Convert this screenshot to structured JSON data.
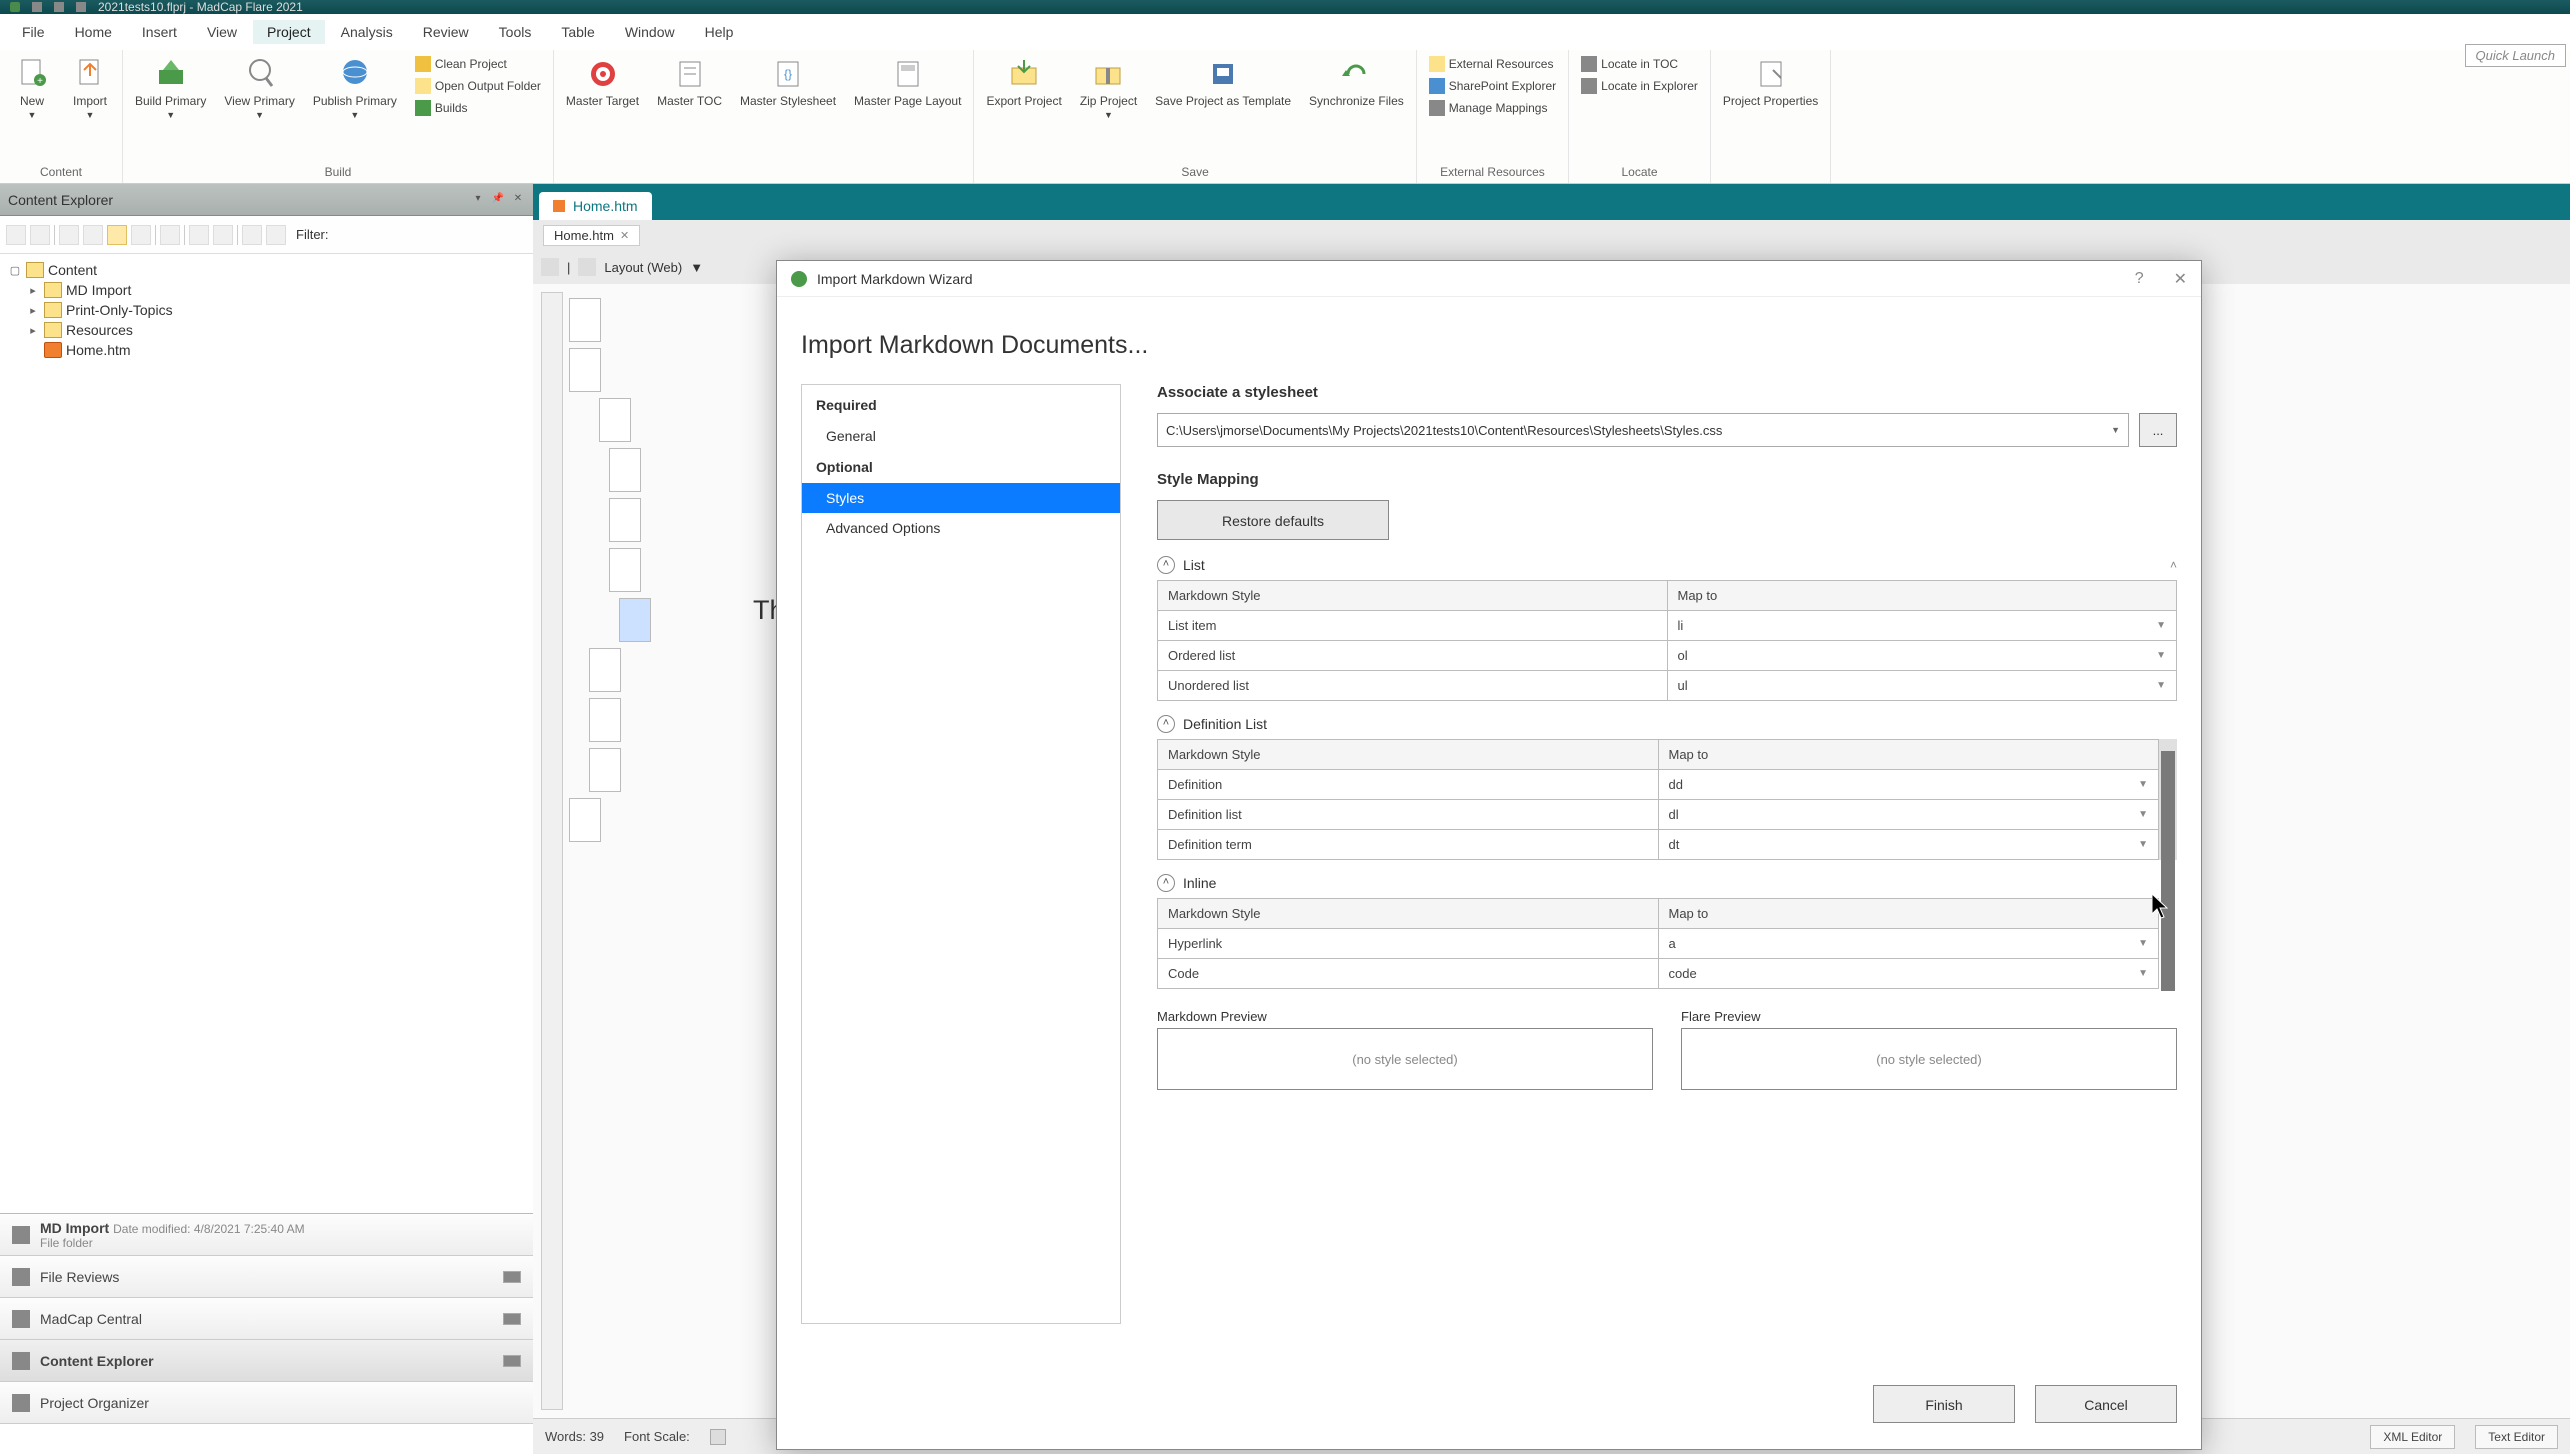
{
  "app": {
    "title": "2021tests10.flprj - MadCap Flare 2021",
    "quick_launch": "Quick Launch"
  },
  "menubar": [
    "File",
    "Home",
    "Insert",
    "View",
    "Project",
    "Analysis",
    "Review",
    "Tools",
    "Table",
    "Window",
    "Help"
  ],
  "menubar_active_index": 4,
  "ribbon": {
    "groups": [
      {
        "label": "Content",
        "items": [
          {
            "t": "New",
            "drop": true,
            "big": true
          },
          {
            "t": "Import",
            "drop": true,
            "big": true
          }
        ]
      },
      {
        "label": "Build",
        "items": [
          {
            "t": "Build Primary",
            "drop": true,
            "big": true
          },
          {
            "t": "View Primary",
            "drop": true,
            "big": true
          },
          {
            "t": "Publish Primary",
            "drop": true,
            "big": true
          }
        ],
        "side": [
          {
            "t": "Clean Project"
          },
          {
            "t": "Open Output Folder"
          },
          {
            "t": "Builds"
          }
        ]
      },
      {
        "label": "",
        "items": [
          {
            "t": "Master Target",
            "big": true
          },
          {
            "t": "Master TOC",
            "big": true
          },
          {
            "t": "Master Stylesheet",
            "big": true
          },
          {
            "t": "Master Page Layout",
            "big": true
          }
        ]
      },
      {
        "label": "Save",
        "items": [
          {
            "t": "Export Project",
            "big": true
          },
          {
            "t": "Zip Project",
            "drop": true,
            "big": true
          },
          {
            "t": "Save Project as Template",
            "big": true
          },
          {
            "t": "Synchronize Files",
            "big": true
          }
        ]
      },
      {
        "label": "External Resources",
        "side": [
          {
            "t": "External Resources"
          },
          {
            "t": "SharePoint Explorer"
          },
          {
            "t": "Manage Mappings"
          }
        ]
      },
      {
        "label": "Locate",
        "side": [
          {
            "t": "Locate in TOC"
          },
          {
            "t": "Locate in Explorer"
          }
        ]
      },
      {
        "label": "",
        "items": [
          {
            "t": "Project Properties",
            "big": true
          }
        ]
      }
    ]
  },
  "panel": {
    "title": "Content Explorer",
    "filter_label": "Filter:"
  },
  "tree": [
    {
      "label": "Content",
      "depth": 0,
      "exp": "-",
      "type": "folder"
    },
    {
      "label": "MD Import",
      "depth": 1,
      "exp": "+",
      "type": "folder"
    },
    {
      "label": "Print-Only-Topics",
      "depth": 1,
      "exp": "+",
      "type": "folder"
    },
    {
      "label": "Resources",
      "depth": 1,
      "exp": "+",
      "type": "folder"
    },
    {
      "label": "Home.htm",
      "depth": 1,
      "exp": "",
      "type": "htm"
    }
  ],
  "panel_bottom": [
    {
      "label": "MD Import",
      "meta": "Date modified:   4/8/2021 7:25:40 AM",
      "sub": "File folder"
    },
    {
      "label": "File Reviews"
    },
    {
      "label": "MadCap Central"
    },
    {
      "label": "Content Explorer",
      "active": true
    },
    {
      "label": "Project Organizer"
    }
  ],
  "doc": {
    "tab_title": "Home.htm",
    "inner_tab": "Home.htm",
    "layout": "Layout (Web)",
    "content_snippet": "sit. This website contains the followi",
    "words_label": "Words:",
    "words": "39",
    "font_scale_label": "Font Scale:",
    "xml": "XML Editor",
    "txt": "Text Editor"
  },
  "wizard": {
    "title": "Import Markdown Wizard",
    "main_title": "Import Markdown Documents...",
    "nav": {
      "required": "Required",
      "general": "General",
      "optional": "Optional",
      "styles": "Styles",
      "advanced": "Advanced Options"
    },
    "associate_label": "Associate a stylesheet",
    "stylesheet_path": "C:\\Users\\jmorse\\Documents\\My Projects\\2021tests10\\Content\\Resources\\Stylesheets\\Styles.css",
    "browse": "...",
    "style_mapping": "Style Mapping",
    "restore": "Restore defaults",
    "col_md": "Markdown Style",
    "col_map": "Map to",
    "groups": [
      {
        "name": "List",
        "rows": [
          [
            "List item",
            "li"
          ],
          [
            "Ordered list",
            "ol"
          ],
          [
            "Unordered list",
            "ul"
          ]
        ]
      },
      {
        "name": "Definition List",
        "rows": [
          [
            "Definition",
            "dd"
          ],
          [
            "Definition list",
            "dl"
          ],
          [
            "Definition term",
            "dt"
          ]
        ]
      },
      {
        "name": "Inline",
        "rows": [
          [
            "Hyperlink",
            "a"
          ],
          [
            "Code",
            "code"
          ]
        ]
      }
    ],
    "preview_md": "Markdown Preview",
    "preview_flare": "Flare Preview",
    "no_style": "(no style selected)",
    "finish": "Finish",
    "cancel": "Cancel"
  }
}
